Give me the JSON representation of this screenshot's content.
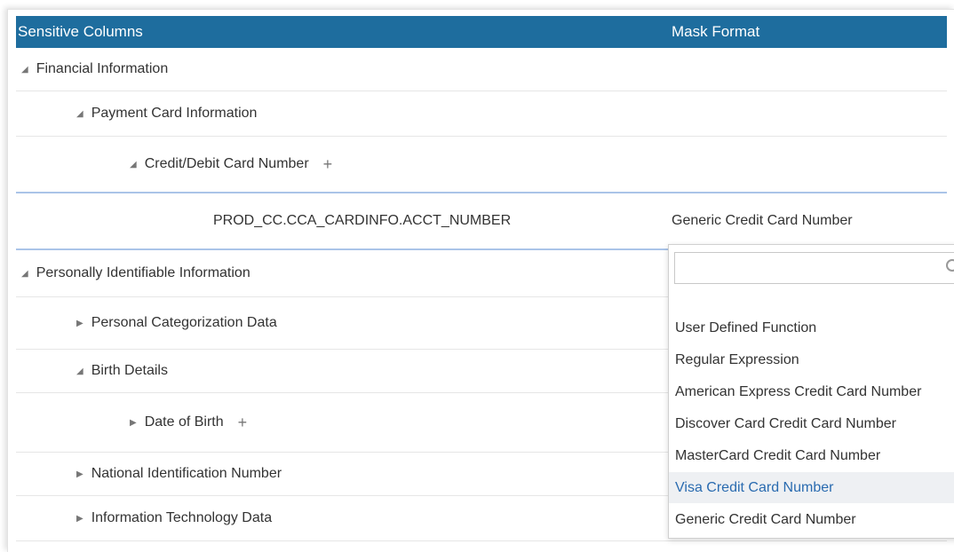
{
  "header": {
    "col_sensitive": "Sensitive Columns",
    "col_mask": "Mask Format"
  },
  "tree": [
    {
      "label": "Financial Information",
      "expanded": true
    },
    {
      "label": "Payment Card Information",
      "expanded": true
    },
    {
      "label": "Credit/Debit Card Number",
      "expanded": true,
      "has_add": true
    },
    {
      "label": "PROD_CC.CCA_CARDINFO.ACCT_NUMBER",
      "mask": "Generic Credit Card Number",
      "selected": true
    },
    {
      "label": "Personally Identifiable Information",
      "expanded": true
    },
    {
      "label": "Personal Categorization Data",
      "expanded": false
    },
    {
      "label": "Birth Details",
      "expanded": true
    },
    {
      "label": "Date of Birth",
      "expanded": false,
      "has_add": true
    },
    {
      "label": "National Identification Number",
      "expanded": false
    },
    {
      "label": "Information Technology Data",
      "expanded": false
    }
  ],
  "add_symbol": "+",
  "icons": {
    "expanded": "triangle-down-icon",
    "collapsed": "triangle-right-icon",
    "add": "plus-icon",
    "search": "search-icon"
  },
  "dropdown": {
    "search_value": "",
    "options": [
      "User Defined Function",
      "Regular Expression",
      "American Express Credit Card Number",
      "Discover Card Credit Card Number",
      "MasterCard Credit Card Number",
      "Visa Credit Card Number",
      "Generic Credit Card Number"
    ],
    "hovered": "Visa Credit Card Number"
  },
  "colors": {
    "header_bg": "#1e6d9e",
    "selected_border": "#aac4e8",
    "hover_text": "#2a6bb0"
  }
}
